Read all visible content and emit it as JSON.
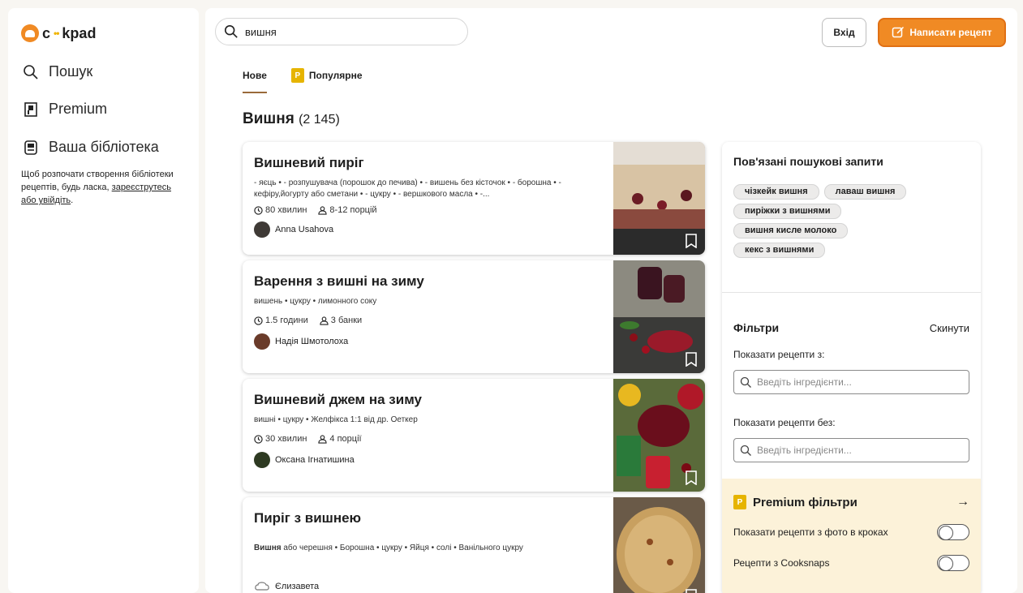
{
  "sidebar": {
    "logo_text": "c",
    "logo_dots": "••",
    "logo_rest": "kpad",
    "nav": [
      {
        "label": "Пошук",
        "icon": "search-icon"
      },
      {
        "label": "Premium",
        "icon": "premium-icon"
      },
      {
        "label": "Ваша бібліотека",
        "icon": "library-icon"
      }
    ],
    "note_text": "Щоб розпочати створення бібліотеки рецептів, будь ласка,",
    "note_link": "зареєструтесь або увійдіть",
    "note_end": "."
  },
  "header": {
    "search_value": "вишня",
    "login_label": "Вхід",
    "write_label": "Написати рецепт"
  },
  "tabs": [
    {
      "label": "Нове",
      "active": true
    },
    {
      "label": "Популярне",
      "active": false,
      "badge": "P"
    }
  ],
  "results": {
    "title": "Вишня",
    "count": "(2 145)"
  },
  "recipes": [
    {
      "title": "Вишневий пиріг",
      "ingredients": "- яєць • - розпушувача (порошок до печива) • - вишень без кісточок • - борошна • - кефіру,йогурту або сметани • - цукру • - вершкового масла • -...",
      "time": "80 хвилин",
      "servings": "8-12 порцій",
      "author": "Anna Usahova"
    },
    {
      "title": "Варення з вишні на зиму",
      "ingredients": "вишень • цукру • лимонного соку",
      "time": "1.5 години",
      "servings": "3 банки",
      "author": "Надія Шмотолоха"
    },
    {
      "title": "Вишневий джем на зиму",
      "ingredients": "вишні • цукру • Желфікса 1:1 від др. Оеткер",
      "time": "30 хвилин",
      "servings": "4 порції",
      "author": "Оксана Ігнатишина"
    },
    {
      "title": "Пиріг з вишнею",
      "ingredients_bold": "Вишня",
      "ingredients": " або черешня • Борошна • цукру • Яйця • солі • Ванільного цукру",
      "author": "Єлизавета"
    }
  ],
  "related": {
    "title": "Пов'язані пошукові запити",
    "chips": [
      "чізкейк вишня",
      "лаваш вишня",
      "пиріжки з вишнями",
      "вишня кисле молоко",
      "кекс з вишнями"
    ]
  },
  "filters": {
    "title": "Фільтри",
    "reset": "Скинути",
    "with_label": "Показати рецепти з:",
    "with_placeholder": "Введіть інгредієнти...",
    "without_label": "Показати рецепти без:",
    "without_placeholder": "Введіть інгредієнти..."
  },
  "premium_filters": {
    "title": "Premium фільтри",
    "badge": "P",
    "arrow": "→",
    "toggles": [
      {
        "label": "Показати рецепти з фото в кроках"
      },
      {
        "label": "Рецепти з Cooksnaps"
      }
    ]
  },
  "colors": {
    "accent": "#f08a24",
    "premium": "#e6b400",
    "premium_bg": "#fcf2d9"
  }
}
